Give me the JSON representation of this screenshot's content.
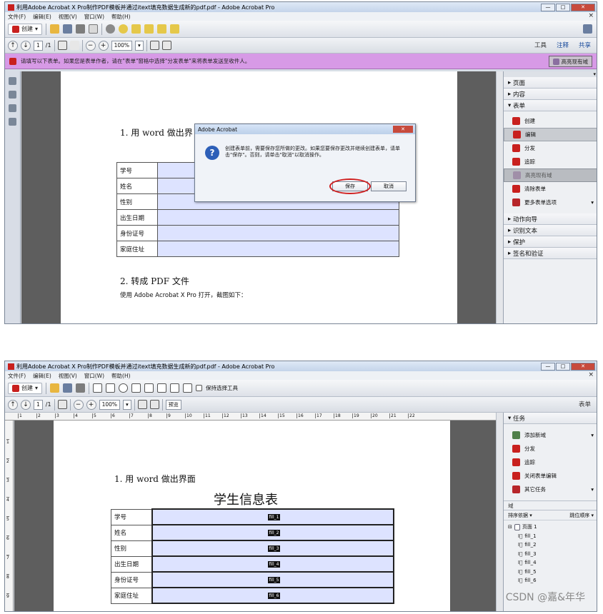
{
  "shot1": {
    "window_title": "利用Adobe Acrobat X Pro制作PDF模板并通过itext填充数据生成新的pdf.pdf - Adobe Acrobat Pro",
    "menus": [
      "文件(F)",
      "编辑(E)",
      "视图(V)",
      "窗口(W)",
      "帮助(H)"
    ],
    "create_label": "创建",
    "page_current": "1",
    "page_total": "/1",
    "zoom": "100%",
    "nav_right": [
      "工具",
      "注释",
      "共享"
    ],
    "form_message": "请填写以下表单。如果您是表单作者，请在\"表单\"窗格中选择\"分发表单\"来将表单发送至收件人。",
    "highlight_fields_btn": "高亮现有域",
    "doc_heading": "1. 用 word 做出界面",
    "doc_heading_visible": "1. 用 word 做出界",
    "table_labels": [
      "学号",
      "姓名",
      "性别",
      "出生日期",
      "身份证号",
      "家庭住址"
    ],
    "doc_heading2": "2. 转成 PDF 文件",
    "doc_paragraph": "使用 Adobe Acrobat X Pro 打开，截图如下：",
    "dialog": {
      "title": "Adobe Acrobat",
      "message": "创建表单前，需要保存您所做的更改。如果您要保存更改并继续创建表单，请单击\"保存\"。否则，请单击\"取消\"以取消操作。",
      "save": "保存",
      "cancel": "取消"
    },
    "panel_sections_top": [
      "页面",
      "内容"
    ],
    "panel_form_section": "表单",
    "panel_form_items": [
      "创建",
      "编辑",
      "分发",
      "追踪",
      "高亮现有域",
      "清除表单",
      "更多表单选项"
    ],
    "panel_sections_bottom": [
      "动作向导",
      "识别文本",
      "保护",
      "签名和验证"
    ]
  },
  "shot2": {
    "window_title": "利用Adobe Acrobat X Pro制作PDF模板并通过itext填充数据生成新的pdf.pdf - Adobe Acrobat Pro",
    "menus": [
      "文件(F)",
      "编辑(E)",
      "视图(V)",
      "窗口(W)",
      "帮助(H)"
    ],
    "create_label": "创建",
    "keep_tool_label": "保持选择工具",
    "page_current": "1",
    "page_total": "/1",
    "zoom": "100%",
    "preview_btn": "预览",
    "right_label": "表单",
    "ruler_numbers": [
      "1",
      "2",
      "3",
      "4",
      "5",
      "6",
      "7",
      "8",
      "9",
      "10",
      "11",
      "12",
      "13",
      "14",
      "15",
      "16",
      "17",
      "18",
      "19",
      "20",
      "21",
      "22"
    ],
    "vruler_numbers": [
      "1",
      "2",
      "3",
      "4",
      "5",
      "6",
      "7",
      "8",
      "9"
    ],
    "doc_heading": "1. 用 word 做出界面",
    "table_title": "学生信息表",
    "table_labels": [
      "学号",
      "姓名",
      "性别",
      "出生日期",
      "身份证号",
      "家庭住址"
    ],
    "field_names": [
      "fill_1",
      "fill_2",
      "fill_3",
      "fill_4",
      "fill_5",
      "fill_6"
    ],
    "tasks_header": "任务",
    "tasks": [
      "添加新域",
      "分发",
      "追踪",
      "关闭表单编辑",
      "其它任务"
    ],
    "fields_header": "域",
    "sort_label": "排序依据",
    "tab_order_label": "跳位顺序",
    "tree_page": "页面 1",
    "tree_fields": [
      "fill_1",
      "fill_2",
      "fill_3",
      "fill_4",
      "fill_5",
      "fill_6"
    ]
  },
  "watermark": "CSDN @嘉&年华"
}
